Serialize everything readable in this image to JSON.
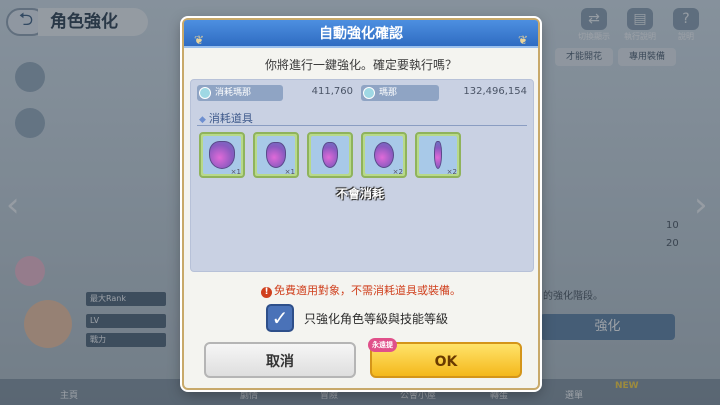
{
  "background": {
    "screen_title": "角色強化",
    "top_icons": [
      {
        "label": "切換顯示",
        "icon": "swap-icon"
      },
      {
        "label": "執行說明",
        "icon": "book-icon"
      },
      {
        "label": "說明",
        "icon": "help-icon"
      }
    ],
    "tabs": [
      "才能開花",
      "專用裝備"
    ],
    "stats": [
      {
        "label": "",
        "value": "10"
      },
      {
        "label": "",
        "value": "20"
      }
    ],
    "rows": [
      "最大Rank",
      "LV",
      "戰力"
    ],
    "enhance_button": "強化",
    "enhance_hint": "的強化階段。",
    "nav": [
      "主頁",
      "劇情",
      "冒險",
      "公會小屋",
      "轉蛋",
      "選單"
    ],
    "nav_badge": "NEW"
  },
  "dialog": {
    "title": "自動強化確認",
    "question": "你將進行一鍵強化。確定要執行嗎？",
    "currency": {
      "cost_label": "消耗瑪那",
      "cost_value": "411,760",
      "owned_label": "瑪那",
      "owned_value": "132,496,154"
    },
    "items_title": "消耗道具",
    "items": [
      {
        "name": "potion-large-icon",
        "qty": "×1"
      },
      {
        "name": "potion-medium-icon",
        "qty": "×1"
      },
      {
        "name": "potion-small-icon",
        "qty": ""
      },
      {
        "name": "potion-round-icon",
        "qty": "×2"
      },
      {
        "name": "potion-tube-icon",
        "qty": "×2"
      }
    ],
    "not_consumed": "不會消耗",
    "warning": "免費適用對象，不需消耗道具或裝備。",
    "checkbox_label": "只強化角色等級與技能等級",
    "checkbox_checked": true,
    "cancel_label": "取消",
    "ok_label": "OK",
    "ok_badge": "永遠提"
  }
}
